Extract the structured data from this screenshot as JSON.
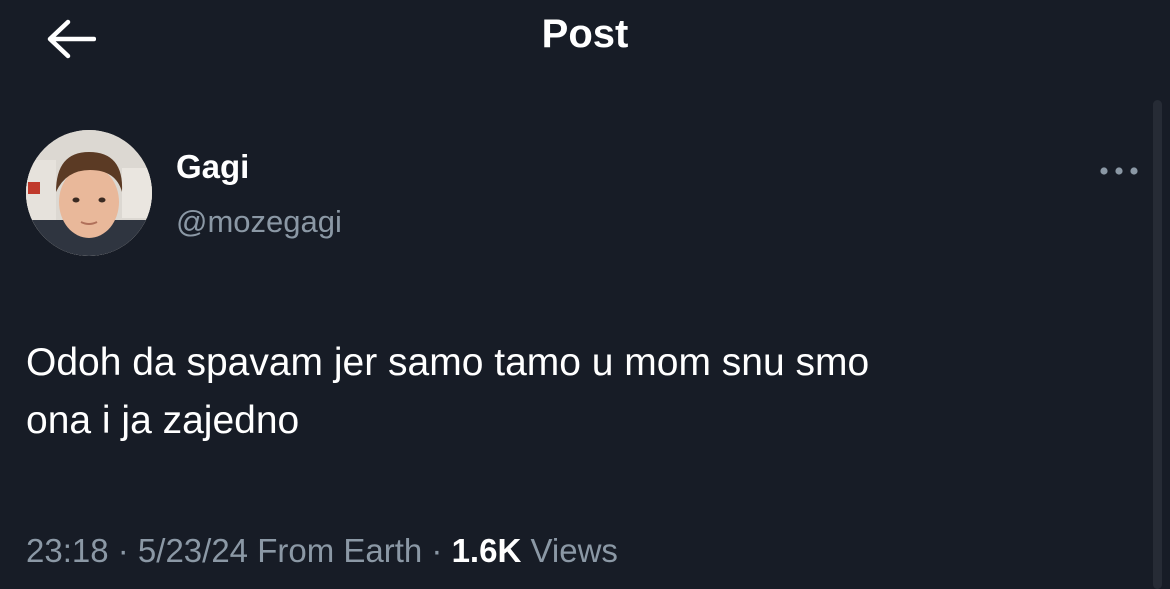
{
  "header": {
    "title": "Post",
    "back_icon": "arrow-left-icon"
  },
  "post": {
    "author": {
      "display_name": "Gagi",
      "handle": "@mozegagi"
    },
    "more_icon": "more-horizontal-icon",
    "text_line1": "Odoh da spavam jer samo tamo u mom snu smo",
    "text_line2": "ona i ja zajedno",
    "meta": {
      "time": "23:18",
      "separator": " · ",
      "date": "5/23/24",
      "location": "From Earth",
      "views_count": "1.6K",
      "views_label": "Views"
    }
  },
  "colors": {
    "background": "#171c26",
    "primary_text": "#ffffff",
    "secondary_text": "#8b98a5"
  }
}
